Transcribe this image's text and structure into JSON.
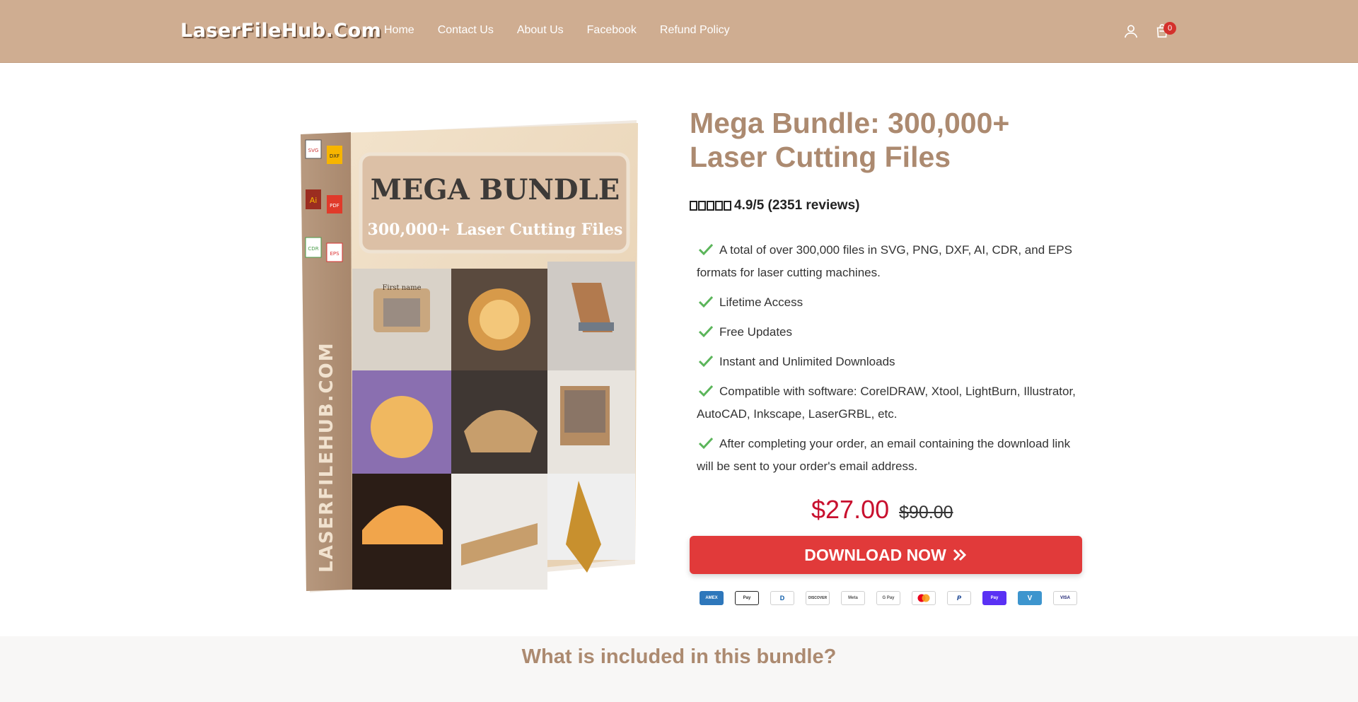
{
  "header": {
    "logo": "LaserFileHub.Com",
    "nav": [
      "Home",
      "Contact Us",
      "About Us",
      "Facebook",
      "Refund Policy"
    ],
    "cart_count": "0"
  },
  "product": {
    "image": {
      "top_text": "MEGA BUNDLE",
      "sub_text": "300,000+ Laser Cutting Files",
      "side_text": "LASERFILEHUB.COM",
      "file_labels": [
        "SVG",
        "DXF",
        "Ai",
        "PDF",
        "CDR",
        "EPS"
      ],
      "photo_caption": "First name"
    },
    "title": "Mega Bundle: 300,000+ Laser Cutting Files",
    "rating_text": "4.9/5 (2351 reviews)",
    "features": [
      "A total of over 300,000 files in SVG, PNG, DXF, AI, CDR, and EPS formats for laser cutting machines.",
      "Lifetime Access",
      "Free Updates",
      "Instant and Unlimited Downloads",
      "Compatible with software: CorelDRAW, Xtool, LightBurn, Illustrator, AutoCAD, Inkscape, LaserGRBL, etc.",
      "After completing your order, an email containing the download link will be sent to your order's email address."
    ],
    "price": "$27.00",
    "compare_price": "$90.00",
    "cta": "DOWNLOAD NOW",
    "payment_methods": [
      "AMEX",
      "Pay",
      "D",
      "DISCOVER",
      "Meta",
      "G Pay",
      "",
      "P",
      "Pay",
      "V",
      "VISA"
    ]
  },
  "included": {
    "heading": "What is included in this bundle?"
  },
  "colors": {
    "header_bg": "#cfad91",
    "title": "#ac8a70",
    "price": "#c8102e",
    "cta_bg": "#e13a3a",
    "check": "#5bb55a"
  }
}
